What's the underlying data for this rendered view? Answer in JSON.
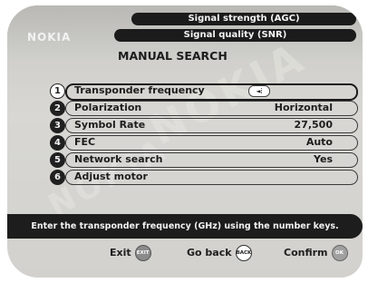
{
  "header": {
    "brand": "NOKIA",
    "meters": {
      "agc_label": "Signal strength (AGC)",
      "snr_label": "Signal quality (SNR)"
    },
    "title": "MANUAL SEARCH"
  },
  "menu": {
    "items": [
      {
        "number": "1",
        "label": "Transponder frequency",
        "value": "",
        "selected": true,
        "input_value": "◄⁞"
      },
      {
        "number": "2",
        "label": "Polarization",
        "value": "Horizontal"
      },
      {
        "number": "3",
        "label": "Symbol Rate",
        "value": "27,500"
      },
      {
        "number": "4",
        "label": "FEC",
        "value": "Auto"
      },
      {
        "number": "5",
        "label": "Network search",
        "value": "Yes"
      },
      {
        "number": "6",
        "label": "Adjust motor",
        "value": ""
      }
    ]
  },
  "hint": "Enter the transponder frequency (GHz) using the number keys.",
  "footer": {
    "exit_label": "Exit",
    "exit_key": "EXIT",
    "exit_key_color": "#8a8a8a",
    "back_label": "Go back",
    "back_key": "BACK",
    "back_key_color": "#ffffff",
    "confirm_label": "Confirm",
    "confirm_key": "OK",
    "confirm_key_color": "#a0a0a0"
  },
  "watermark": "NOKIA"
}
